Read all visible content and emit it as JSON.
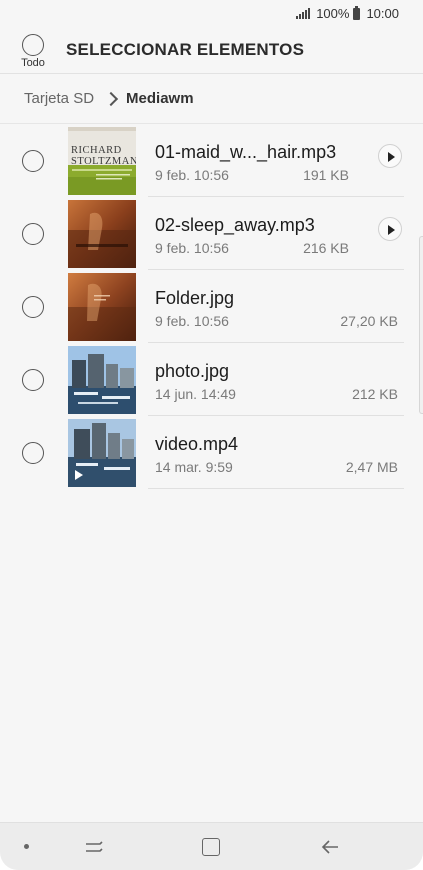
{
  "status_bar": {
    "battery": "100%",
    "time": "10:00"
  },
  "header": {
    "select_all_label": "Todo",
    "title": "SELECCIONAR ELEMENTOS"
  },
  "breadcrumb": {
    "root": "Tarjeta SD",
    "current": "Mediawm"
  },
  "files": [
    {
      "name": "01-maid_w..._hair.mp3",
      "date": "9 feb. 10:56",
      "size": "191 KB",
      "type": "audio",
      "thumb_text": [
        "RICHARD",
        "STOLTZMAN"
      ]
    },
    {
      "name": "02-sleep_away.mp3",
      "date": "9 feb. 10:56",
      "size": "216 KB",
      "type": "audio"
    },
    {
      "name": "Folder.jpg",
      "date": "9 feb. 10:56",
      "size": "27,20 KB",
      "type": "image"
    },
    {
      "name": "photo.jpg",
      "date": "14 jun. 14:49",
      "size": "212 KB",
      "type": "image"
    },
    {
      "name": "video.mp4",
      "date": "14 mar. 9:59",
      "size": "2,47 MB",
      "type": "video"
    }
  ],
  "icons": {
    "select": "circle-checkbox-icon",
    "play": "play-icon",
    "breadcrumb_separator": "chevron-right-icon",
    "nav": [
      "dot-icon",
      "recent-apps-icon",
      "home-icon",
      "back-icon"
    ]
  },
  "colors": {
    "background": "#f6f6f6",
    "text": "#1c1c1c",
    "secondary_text": "#7a7a7a",
    "navbar": "#ececec"
  }
}
